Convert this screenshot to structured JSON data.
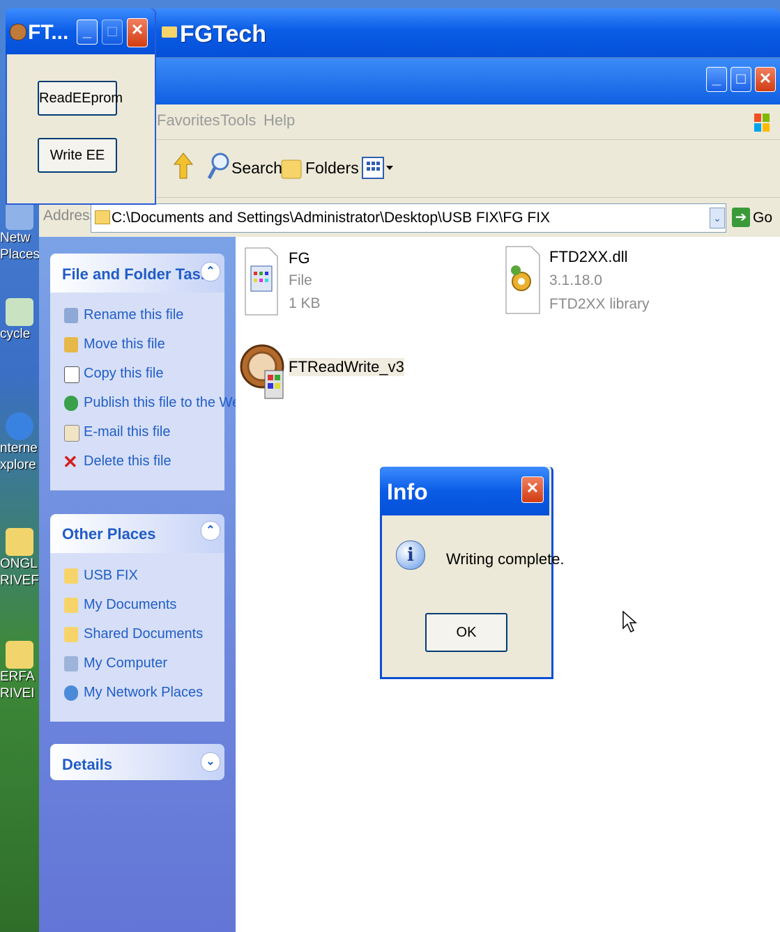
{
  "desktop": {
    "icons": [
      {
        "label_line1": "Netw",
        "label_line2": "Places",
        "color": "#8fb3e8"
      },
      {
        "label_line1": "cycle",
        "label_line2": "",
        "color": "#c9e3c2"
      },
      {
        "label_line1": "nterne",
        "label_line2": "xplore",
        "color": "#3a82e0"
      },
      {
        "label_line1": "ONGL",
        "label_line2": "RIVEF",
        "color": "#f1d56c"
      },
      {
        "label_line1": "ERFA",
        "label_line2": "RIVEI",
        "color": "#f1d56c"
      }
    ]
  },
  "explorer": {
    "title": "FGTech",
    "menu": [
      "Favorites",
      "Tools",
      "Help"
    ],
    "toolbar": {
      "search": "Search",
      "folders": "Folders"
    },
    "address": {
      "label": "Address",
      "path": "C:\\Documents and Settings\\Administrator\\Desktop\\USB FIX\\FG FIX",
      "go": "Go"
    },
    "tasks_panel": {
      "title": "File and Folder Tasks",
      "items": [
        "Rename this file",
        "Move this file",
        "Copy this file",
        "Publish this file to the Web",
        "E-mail this file",
        "Delete this file"
      ]
    },
    "places_panel": {
      "title": "Other Places",
      "items": [
        "USB FIX",
        "My Documents",
        "Shared Documents",
        "My Computer",
        "My Network Places"
      ]
    },
    "details_panel": {
      "title": "Details"
    },
    "files": [
      {
        "name": "FG",
        "type": "File",
        "size": "1 KB"
      },
      {
        "name": "FTD2XX.dll",
        "version": "3.1.18.0",
        "desc": "FTD2XX library"
      },
      {
        "name": "FTReadWrite_v3"
      }
    ]
  },
  "ft_window": {
    "title": "FT...",
    "buttons": {
      "read": "ReadEEprom",
      "write": "Write EE"
    }
  },
  "info_dialog": {
    "title": "Info",
    "message": "Writing complete.",
    "ok": "OK"
  }
}
